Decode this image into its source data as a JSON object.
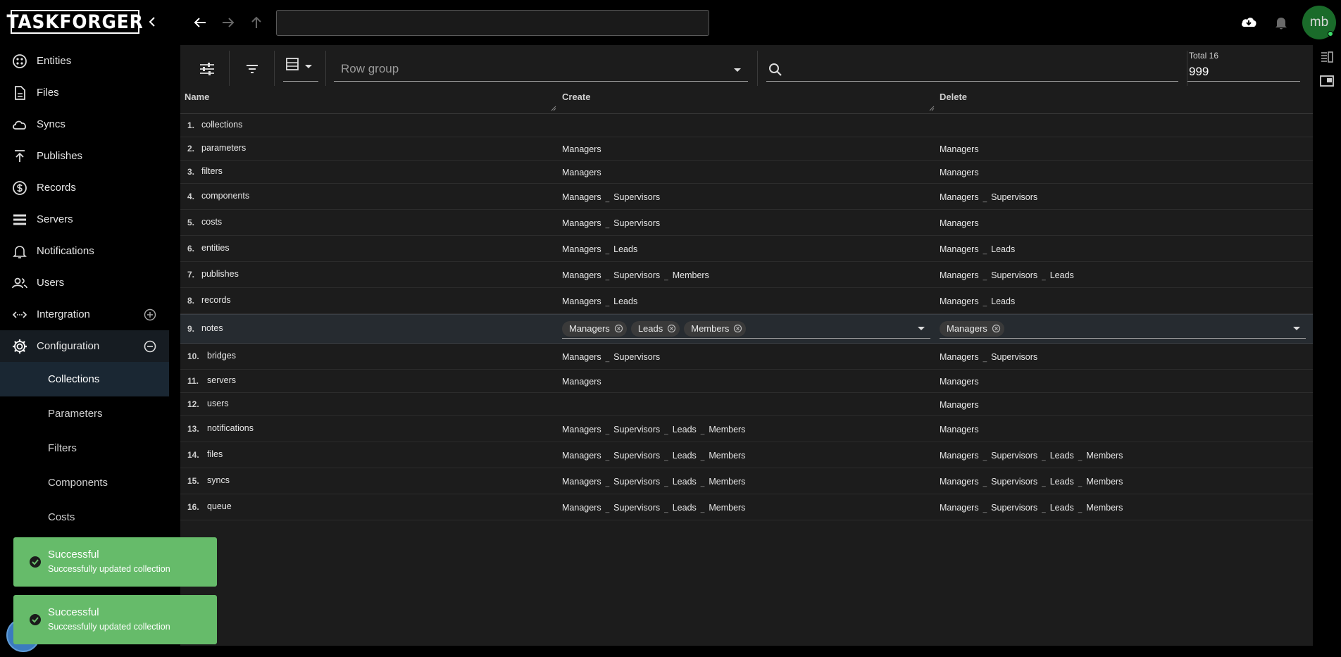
{
  "app": {
    "logo_text": "TASKFORGER",
    "user_initials": "mb",
    "address_value": ""
  },
  "sidebar": {
    "items": [
      {
        "label": "Entities",
        "icon": "entities-icon"
      },
      {
        "label": "Files",
        "icon": "file-icon"
      },
      {
        "label": "Syncs",
        "icon": "cloud-sync-icon"
      },
      {
        "label": "Publishes",
        "icon": "publish-icon"
      },
      {
        "label": "Records",
        "icon": "dollar-icon"
      },
      {
        "label": "Servers",
        "icon": "server-icon"
      },
      {
        "label": "Notifications",
        "icon": "bell-icon"
      },
      {
        "label": "Users",
        "icon": "users-icon"
      },
      {
        "label": "Intergration",
        "icon": "integration-icon"
      },
      {
        "label": "Configuration",
        "icon": "gear-icon"
      }
    ],
    "sub_items": [
      "Collections",
      "Parameters",
      "Filters",
      "Components",
      "Costs"
    ],
    "active_sub": "Collections"
  },
  "toolbar": {
    "row_group_placeholder": "Row group",
    "search_value": "",
    "total_label": "Total 16",
    "page_size": "999"
  },
  "table": {
    "columns": [
      "Name",
      "Create",
      "Delete"
    ],
    "rows": [
      {
        "num": "1.",
        "name": "collections",
        "create": [],
        "delete": []
      },
      {
        "num": "2.",
        "name": "parameters",
        "create": [
          "Managers"
        ],
        "delete": [
          "Managers"
        ]
      },
      {
        "num": "3.",
        "name": "filters",
        "create": [
          "Managers"
        ],
        "delete": [
          "Managers"
        ]
      },
      {
        "num": "4.",
        "name": "components",
        "create": [
          "Managers",
          "Supervisors"
        ],
        "delete": [
          "Managers",
          "Supervisors"
        ]
      },
      {
        "num": "5.",
        "name": "costs",
        "create": [
          "Managers",
          "Supervisors"
        ],
        "delete": [
          "Managers"
        ]
      },
      {
        "num": "6.",
        "name": "entities",
        "create": [
          "Managers",
          "Leads"
        ],
        "delete": [
          "Managers",
          "Leads"
        ]
      },
      {
        "num": "7.",
        "name": "publishes",
        "create": [
          "Managers",
          "Supervisors",
          "Members"
        ],
        "delete": [
          "Managers",
          "Supervisors",
          "Leads"
        ]
      },
      {
        "num": "8.",
        "name": "records",
        "create": [
          "Managers",
          "Leads"
        ],
        "delete": [
          "Managers",
          "Leads"
        ]
      },
      {
        "num": "9.",
        "name": "notes",
        "create": [
          "Managers",
          "Leads",
          "Members"
        ],
        "delete": [
          "Managers"
        ],
        "editing": true
      },
      {
        "num": "10.",
        "name": "bridges",
        "create": [
          "Managers",
          "Supervisors"
        ],
        "delete": [
          "Managers",
          "Supervisors"
        ]
      },
      {
        "num": "11.",
        "name": "servers",
        "create": [
          "Managers"
        ],
        "delete": [
          "Managers"
        ]
      },
      {
        "num": "12.",
        "name": "users",
        "create": [],
        "delete": [
          "Managers"
        ]
      },
      {
        "num": "13.",
        "name": "notifications",
        "create": [
          "Managers",
          "Supervisors",
          "Leads",
          "Members"
        ],
        "delete": [
          "Managers"
        ]
      },
      {
        "num": "14.",
        "name": "files",
        "create": [
          "Managers",
          "Supervisors",
          "Leads",
          "Members"
        ],
        "delete": [
          "Managers",
          "Supervisors",
          "Leads",
          "Members"
        ]
      },
      {
        "num": "15.",
        "name": "syncs",
        "create": [
          "Managers",
          "Supervisors",
          "Leads",
          "Members"
        ],
        "delete": [
          "Managers",
          "Supervisors",
          "Leads",
          "Members"
        ]
      },
      {
        "num": "16.",
        "name": "queue",
        "create": [
          "Managers",
          "Supervisors",
          "Leads",
          "Members"
        ],
        "delete": [
          "Managers",
          "Supervisors",
          "Leads",
          "Members"
        ]
      }
    ]
  },
  "toasts": [
    {
      "title": "Successful",
      "message": "Successfully updated collection"
    },
    {
      "title": "Successful",
      "message": "Successfully updated collection"
    }
  ],
  "colors": {
    "toast_bg": "#66bb6a",
    "avatar_bg": "#1a6b2a",
    "selected_row": "#262b30"
  }
}
